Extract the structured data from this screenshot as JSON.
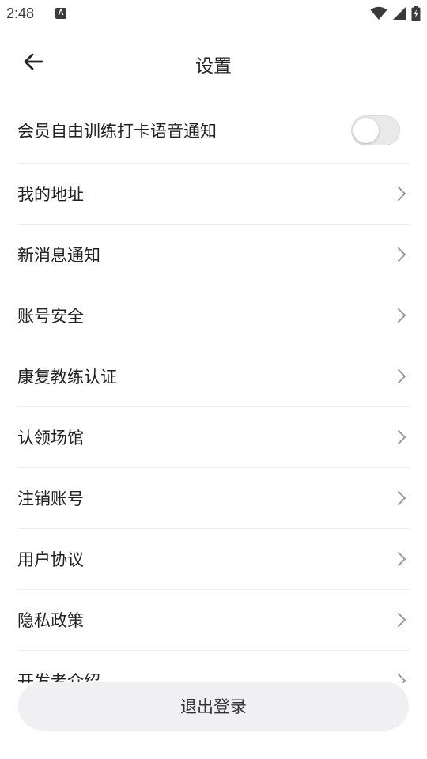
{
  "status_bar": {
    "time": "2:48",
    "notification_badge": "A",
    "icons": [
      "wifi-icon",
      "cellular-signal-icon",
      "battery-charging-icon"
    ]
  },
  "header": {
    "back_icon": "arrow-left-icon",
    "title": "设置"
  },
  "settings": {
    "toggle_item": {
      "label": "会员自由训练打卡语音通知",
      "enabled": false
    },
    "items": [
      {
        "label": "我的地址",
        "icon": "chevron-right-icon"
      },
      {
        "label": "新消息通知",
        "icon": "chevron-right-icon"
      },
      {
        "label": "账号安全",
        "icon": "chevron-right-icon"
      },
      {
        "label": "康复教练认证",
        "icon": "chevron-right-icon"
      },
      {
        "label": "认领场馆",
        "icon": "chevron-right-icon"
      },
      {
        "label": "注销账号",
        "icon": "chevron-right-icon"
      },
      {
        "label": "用户协议",
        "icon": "chevron-right-icon"
      },
      {
        "label": "隐私政策",
        "icon": "chevron-right-icon"
      },
      {
        "label": "开发者介绍",
        "icon": "chevron-right-icon"
      }
    ]
  },
  "footer": {
    "logout_label": "退出登录"
  },
  "colors": {
    "background": "#ffffff",
    "text_primary": "#222222",
    "divider": "#ececec",
    "chevron": "#9a9a9a",
    "toggle_off_track": "#e9e9e9",
    "logout_button_bg": "#f0f0f2"
  }
}
